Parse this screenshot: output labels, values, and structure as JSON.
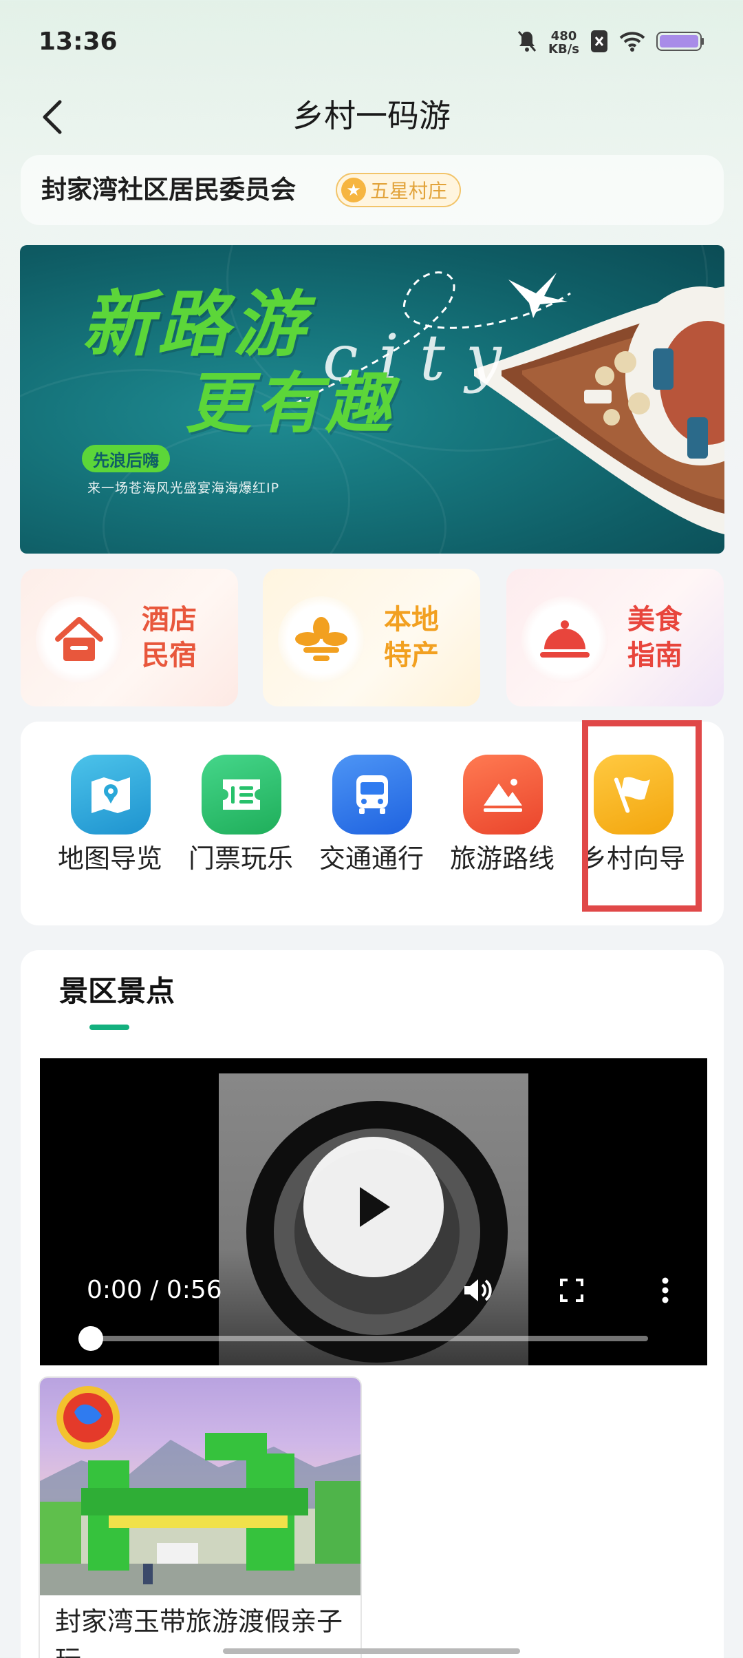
{
  "status_bar": {
    "time": "13:36",
    "net_speed_value": "480",
    "net_speed_unit": "KB/s"
  },
  "nav": {
    "title": "乡村一码游"
  },
  "village": {
    "name": "封家湾社区居民委员会",
    "badge": "五星村庄"
  },
  "banner": {
    "headline_1": "新路游",
    "headline_2": "更有趣",
    "decor": "city",
    "tag": "先浪后嗨",
    "subtitle": "来一场苍海风光盛宴海海爆红IP"
  },
  "categories": [
    {
      "line1": "酒店",
      "line2": "民宿",
      "icon": "house-icon",
      "color": "#e8573c"
    },
    {
      "line1": "本地",
      "line2": "特产",
      "icon": "flower-icon",
      "color": "#f2a020"
    },
    {
      "line1": "美食",
      "line2": "指南",
      "icon": "food-cloche-icon",
      "color": "#e8453c"
    }
  ],
  "quick_actions": [
    {
      "label": "地图导览",
      "icon": "map-icon",
      "color": "#2aa8d8"
    },
    {
      "label": "门票玩乐",
      "icon": "ticket-icon",
      "color": "#27c16b"
    },
    {
      "label": "交通通行",
      "icon": "bus-icon",
      "color": "#2f7bf0"
    },
    {
      "label": "旅游路线",
      "icon": "mountain-route-icon",
      "color": "#f0563a"
    },
    {
      "label": "乡村向导",
      "icon": "flag-icon",
      "color": "#f6b21c"
    }
  ],
  "scenic": {
    "title": "景区景点",
    "video": {
      "time": "0:00 / 0:56"
    },
    "spots": [
      {
        "title": "封家湾玉带旅游渡假亲子玩"
      }
    ]
  },
  "colors": {
    "accent": "#13b07e",
    "highlight": "#e04848"
  }
}
